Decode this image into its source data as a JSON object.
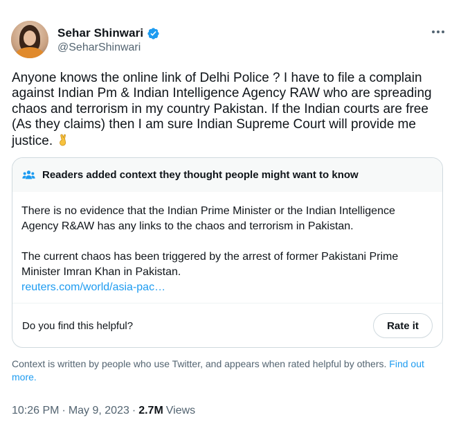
{
  "author": {
    "display_name": "Sehar Shinwari",
    "handle": "@SeharShinwari",
    "verified": true
  },
  "tweet": {
    "text": "Anyone knows the online link of Delhi Police ? I have to file a complain against Indian Pm & Indian Intelligence Agency RAW who are spreading chaos and terrorism in my country Pakistan. If the Indian courts are free (As they claims) then I am sure Indian Supreme Court will provide me justice.",
    "emoji": "crossed-fingers-emoji"
  },
  "context": {
    "title": "Readers added context they thought people might want to know",
    "paragraph_1": "There is no evidence that the Indian Prime Minister or the Indian Intelligence Agency R&AW has any links to the chaos and terrorism in Pakistan.",
    "paragraph_2": "The current chaos has been triggered by the arrest of former Pakistani Prime Minister Imran Khan in Pakistan.",
    "link": "reuters.com/world/asia-pac…",
    "helpful_question": "Do you find this helpful?",
    "rate_button": "Rate it"
  },
  "context_note": {
    "text": "Context is written by people who use Twitter, and appears when rated helpful by others.",
    "find_out_more": "Find out more."
  },
  "meta": {
    "time": "10:26 PM",
    "separator": "·",
    "date": "May 9, 2023",
    "views_count": "2.7M",
    "views_label": "Views"
  },
  "colors": {
    "accent": "#1d9bf0",
    "text": "#0f1419",
    "secondary": "#536471",
    "border": "#cfd9de"
  }
}
